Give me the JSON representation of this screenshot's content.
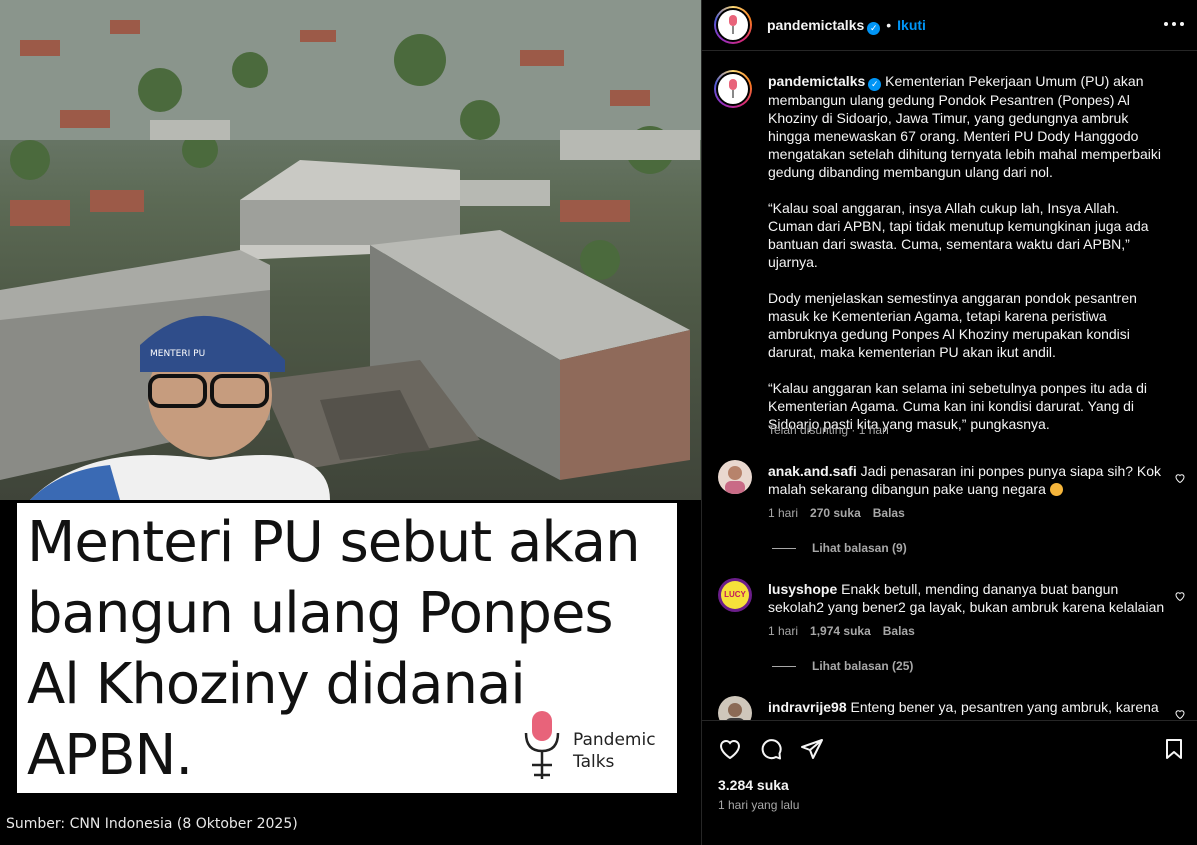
{
  "image": {
    "headline": "Menteri PU sebut akan bangun ulang Ponpes Al Khoziny didanai APBN.",
    "brand_name": "Pandemic\nTalks",
    "cap_text": "MENTERI PU",
    "source": "Sumber: CNN Indonesia (8 Oktober 2025)"
  },
  "header": {
    "username": "pandemictalks",
    "follow_label": "Ikuti",
    "separator": "•"
  },
  "caption": {
    "username": "pandemictalks",
    "paragraphs": [
      "Kementerian Pekerjaan Umum (PU) akan membangun ulang gedung Pondok Pesantren (Ponpes) Al Khoziny di Sidoarjo, Jawa Timur, yang gedungnya ambruk hingga menewaskan 67 orang. Menteri PU Dody Hanggodo mengatakan setelah dihitung ternyata lebih mahal memperbaiki gedung dibanding membangun ulang dari nol.",
      "“Kalau soal anggaran, insya Allah cukup lah, Insya Allah. Cuman dari APBN, tapi tidak menutup kemungkinan juga ada bantuan dari swasta. Cuma, sementara waktu dari APBN,” ujarnya.",
      "Dody menjelaskan semestinya anggaran pondok pesantren masuk ke Kementerian Agama, tetapi karena peristiwa ambruknya gedung Ponpes Al Khoziny merupakan kondisi darurat, maka kementerian PU akan ikut andil.",
      "“Kalau anggaran kan selama ini sebetulnya ponpes itu ada di Kementerian Agama. Cuma kan ini kondisi darurat. Yang di Sidoarjo pasti kita yang masuk,” pungkasnya."
    ],
    "edited": "Telah disunting · 1 hari"
  },
  "comments": [
    {
      "username": "anak.and.safi",
      "text": "Jadi penasaran ini ponpes punya siapa sih? Kok malah sekarang dibangun pake uang negara",
      "time": "1 hari",
      "likes": "270 suka",
      "reply": "Balas",
      "view_replies": "Lihat balasan (9)"
    },
    {
      "username": "lusyshope",
      "text": "Enakk betull, mending dananya buat bangun sekolah2 yang bener2 ga layak, bukan ambruk karena kelalaian",
      "time": "1 hari",
      "likes": "1,974 suka",
      "reply": "Balas",
      "view_replies": "Lihat balasan (25)",
      "avatar_text": "LUCY"
    },
    {
      "username": "indravrije98",
      "text": "Enteng bener ya, pesantren yang ambruk, karena"
    }
  ],
  "footer": {
    "likes": "3.284 suka",
    "time_ago": "1 hari yang lalu"
  }
}
